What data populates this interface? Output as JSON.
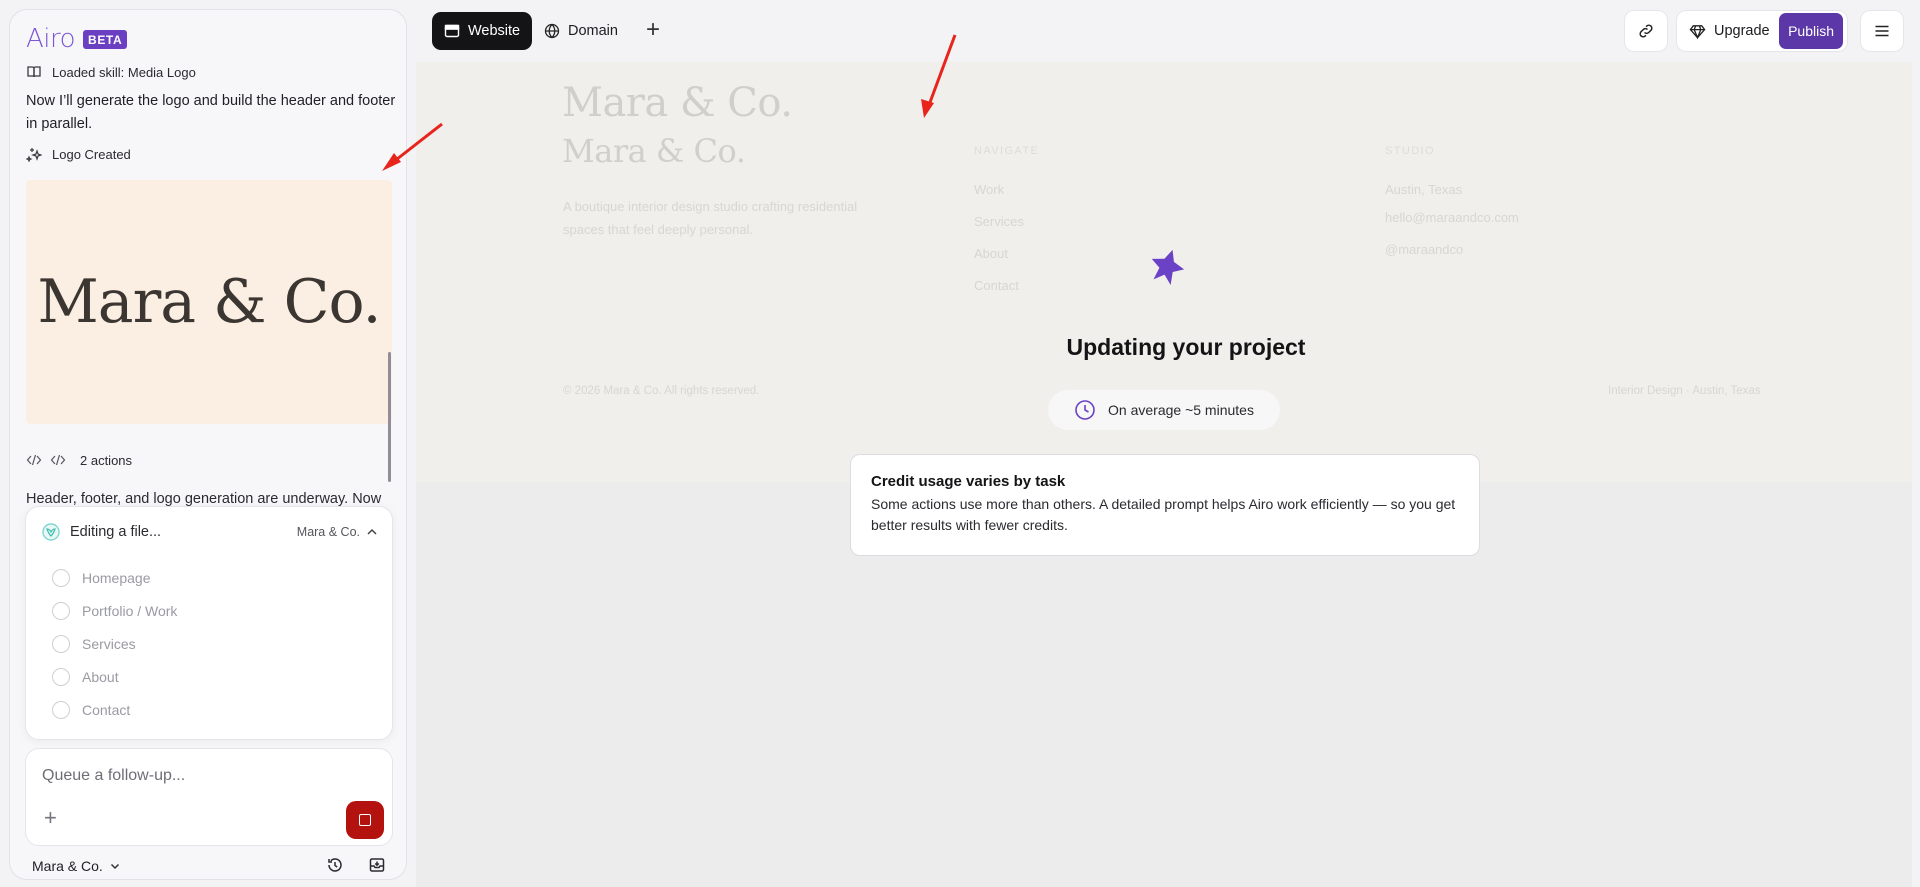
{
  "brand": {
    "name": "Airo",
    "badge": "BETA"
  },
  "chat": {
    "skill_label": "Loaded skill: Media Logo",
    "message": "Now I’ll generate the logo and build the header and footer in parallel.",
    "logo_created_label": "Logo Created",
    "logo_image_text": "Mara & Co.",
    "actions_label": "2 actions",
    "trailing_message": "Header, footer, and logo generation are underway. Now"
  },
  "editing": {
    "title": "Editing a file...",
    "project": "Mara & Co.",
    "steps": [
      "Homepage",
      "Portfolio / Work",
      "Services",
      "About",
      "Contact"
    ]
  },
  "composer": {
    "placeholder": "Queue a follow-up..."
  },
  "footer": {
    "project_name": "Mara & Co."
  },
  "topbar": {
    "tab_website": "Website",
    "tab_domain": "Domain",
    "upgrade": "Upgrade",
    "publish": "Publish"
  },
  "preview_ghost": {
    "brand": "Mara & Co.",
    "tagline": "A boutique interior design studio crafting residential spaces that feel deeply personal.",
    "nav_heading": "NAVIGATE",
    "nav_links": [
      "Work",
      "Services",
      "About",
      "Contact"
    ],
    "studio_heading": "STUDIO",
    "studio_lines": [
      "Austin, Texas",
      "hello@maraandco.com",
      "@maraandco"
    ],
    "copyright": "© 2026 Mara & Co. All rights reserved.",
    "footer_right": "Interior Design · Austin, Texas"
  },
  "progress": {
    "title": "Updating your project",
    "eta": "On average ~5 minutes"
  },
  "credit_card": {
    "title": "Credit usage varies by task",
    "body": "Some actions use more than others. A detailed prompt helps Airo work efficiently — so you get better results with fewer credits."
  },
  "colors": {
    "brand_purple": "#7b55d6",
    "publish_purple": "#5c37a8",
    "stop_red": "#b3120f",
    "annotation_red": "#e8241c"
  }
}
